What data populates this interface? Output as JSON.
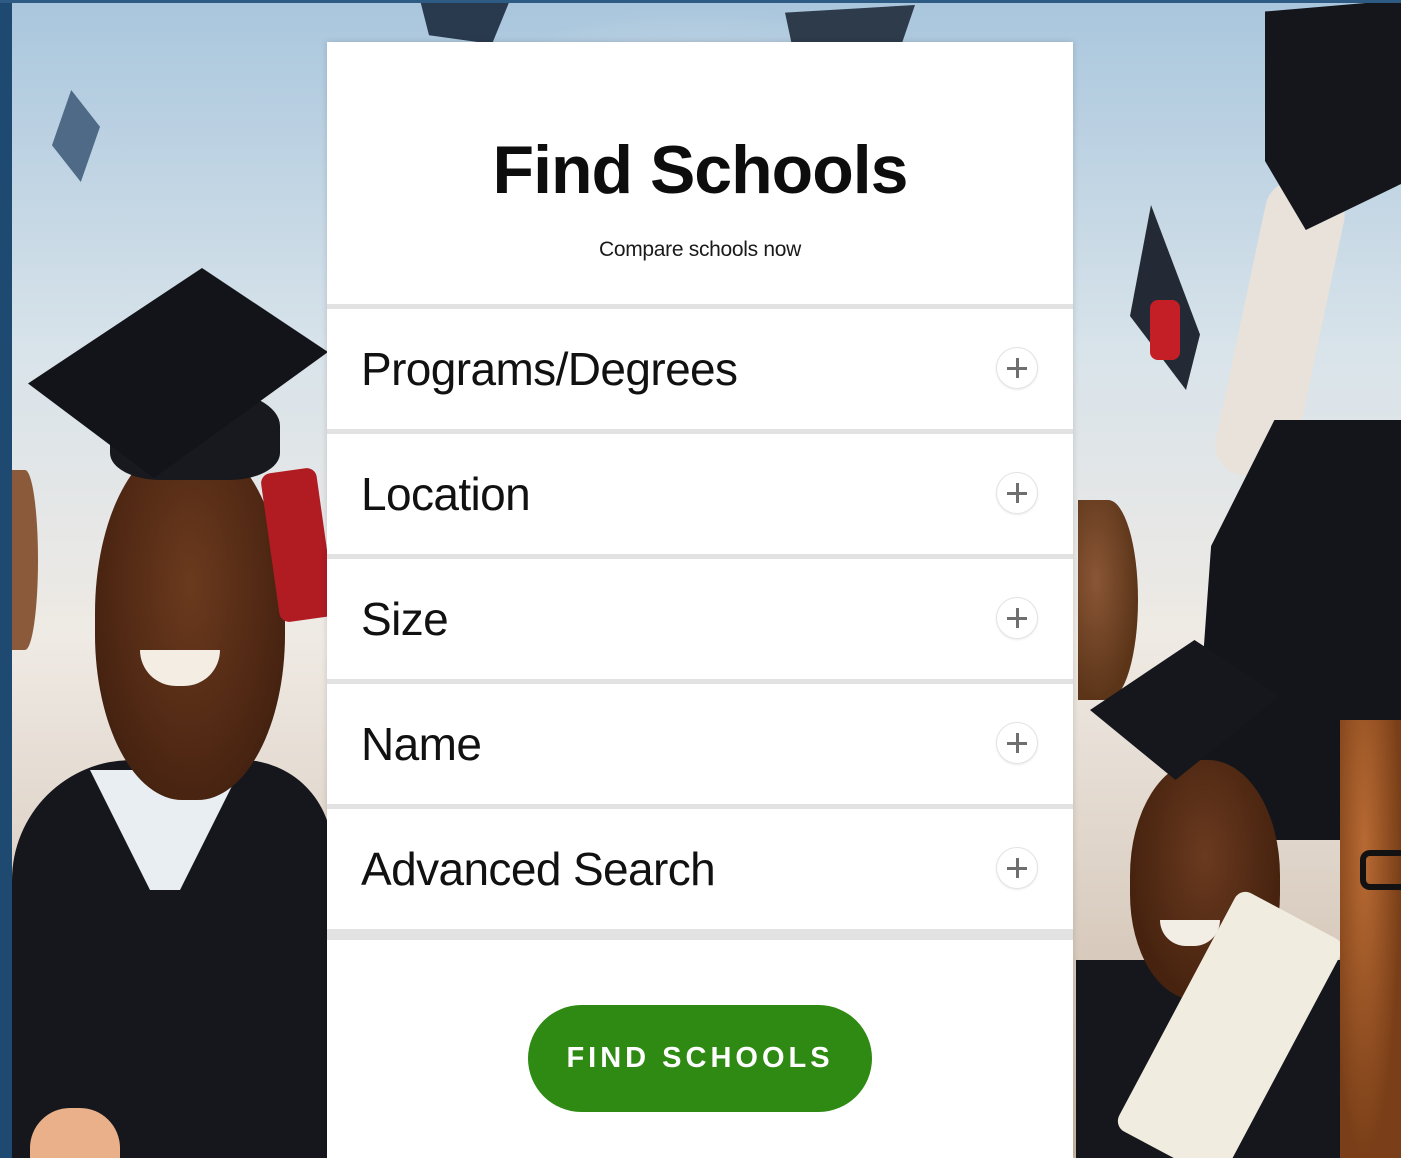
{
  "finder": {
    "title": "Find Schools",
    "subtitle": "Compare schools now",
    "filters": [
      {
        "label": "Programs/Degrees",
        "icon": "plus-icon"
      },
      {
        "label": "Location",
        "icon": "plus-icon"
      },
      {
        "label": "Size",
        "icon": "plus-icon"
      },
      {
        "label": "Name",
        "icon": "plus-icon"
      },
      {
        "label": "Advanced Search",
        "icon": "plus-icon"
      }
    ],
    "submit_label": "FIND SCHOOLS"
  },
  "colors": {
    "button": "#2e8a12",
    "card": "#ffffff",
    "divider": "#e2e2e2",
    "top_rule": "#2d5b83"
  }
}
